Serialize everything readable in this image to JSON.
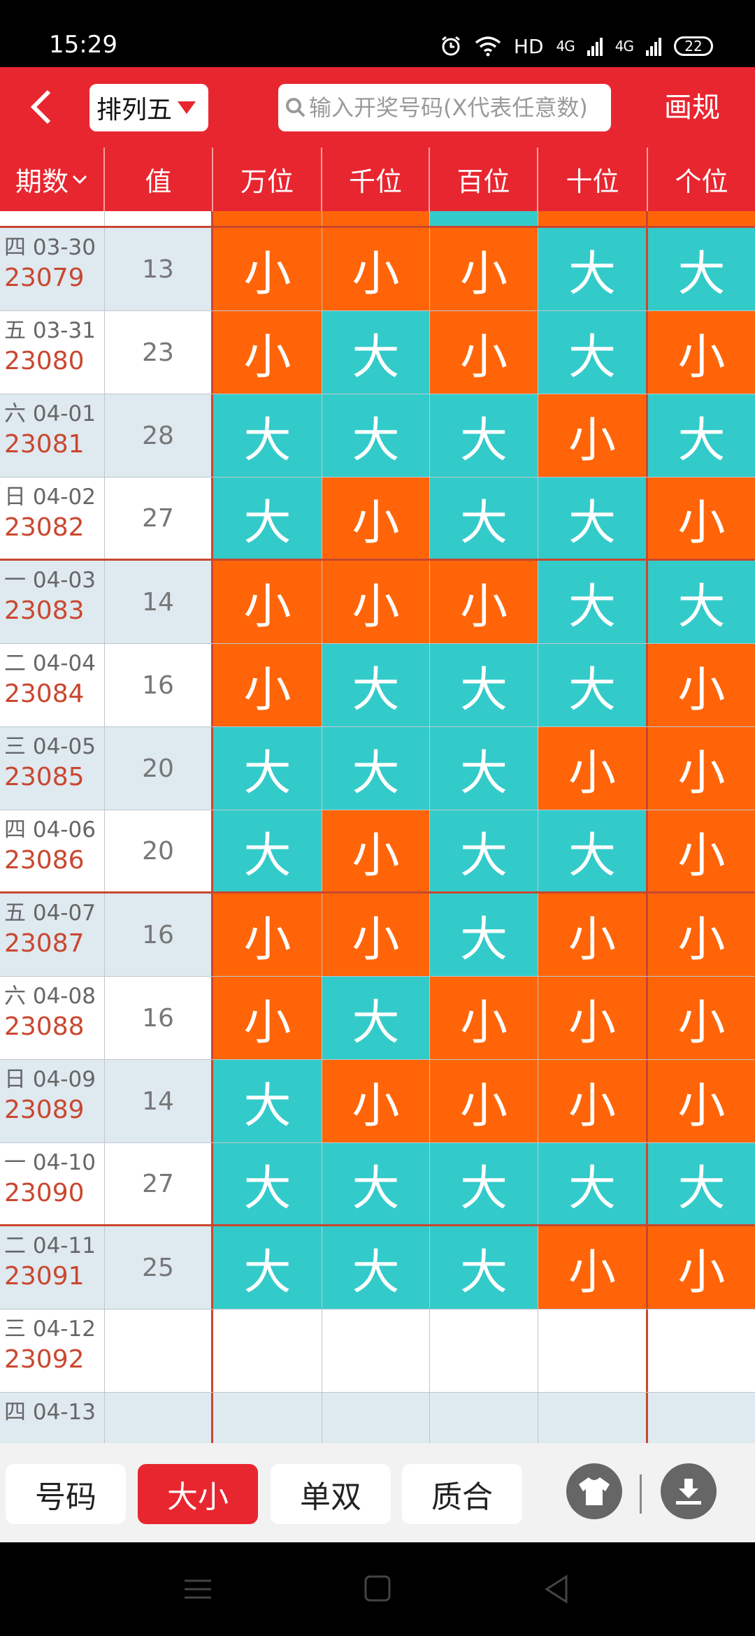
{
  "status": {
    "time": "15:29",
    "network": "HD",
    "signal1": "4G",
    "signal2": "4G",
    "battery": "22"
  },
  "topbar": {
    "lottery": "排列五",
    "search_placeholder": "输入开奖号码(X代表任意数)",
    "draw_rule": "画规"
  },
  "columns": [
    "期数",
    "值",
    "万位",
    "千位",
    "百位",
    "十位",
    "个位"
  ],
  "rows": [
    {
      "date": "四 03-30",
      "issue": "23079",
      "value": "13",
      "cells": [
        "小",
        "小",
        "小",
        "大",
        "大"
      ]
    },
    {
      "date": "五 03-31",
      "issue": "23080",
      "value": "23",
      "cells": [
        "小",
        "大",
        "小",
        "大",
        "小"
      ]
    },
    {
      "date": "六 04-01",
      "issue": "23081",
      "value": "28",
      "cells": [
        "大",
        "大",
        "大",
        "小",
        "大"
      ]
    },
    {
      "date": "日 04-02",
      "issue": "23082",
      "value": "27",
      "cells": [
        "大",
        "小",
        "大",
        "大",
        "小"
      ]
    },
    {
      "date": "一 04-03",
      "issue": "23083",
      "value": "14",
      "cells": [
        "小",
        "小",
        "小",
        "大",
        "大"
      ]
    },
    {
      "date": "二 04-04",
      "issue": "23084",
      "value": "16",
      "cells": [
        "小",
        "大",
        "大",
        "大",
        "小"
      ]
    },
    {
      "date": "三 04-05",
      "issue": "23085",
      "value": "20",
      "cells": [
        "大",
        "大",
        "大",
        "小",
        "小"
      ]
    },
    {
      "date": "四 04-06",
      "issue": "23086",
      "value": "20",
      "cells": [
        "大",
        "小",
        "大",
        "大",
        "小"
      ]
    },
    {
      "date": "五 04-07",
      "issue": "23087",
      "value": "16",
      "cells": [
        "小",
        "小",
        "大",
        "小",
        "小"
      ]
    },
    {
      "date": "六 04-08",
      "issue": "23088",
      "value": "16",
      "cells": [
        "小",
        "大",
        "小",
        "小",
        "小"
      ]
    },
    {
      "date": "日 04-09",
      "issue": "23089",
      "value": "14",
      "cells": [
        "大",
        "小",
        "小",
        "小",
        "小"
      ]
    },
    {
      "date": "一 04-10",
      "issue": "23090",
      "value": "27",
      "cells": [
        "大",
        "大",
        "大",
        "大",
        "大"
      ]
    },
    {
      "date": "二 04-11",
      "issue": "23091",
      "value": "25",
      "cells": [
        "大",
        "大",
        "大",
        "小",
        "小"
      ]
    },
    {
      "date": "三 04-12",
      "issue": "23092",
      "value": "",
      "cells": [
        "",
        "",
        "",
        "",
        ""
      ]
    },
    {
      "date": "四 04-13",
      "issue": "",
      "value": "",
      "cells": [
        "",
        "",
        "",
        "",
        ""
      ]
    }
  ],
  "toolbar": {
    "tabs": [
      "号码",
      "大小",
      "单双",
      "质合"
    ],
    "active_tab": "大小"
  },
  "colors": {
    "brand_red": "#e8262f",
    "small_orange": "#ff6508",
    "big_teal": "#33cbc9",
    "group_line": "#c9472f"
  }
}
